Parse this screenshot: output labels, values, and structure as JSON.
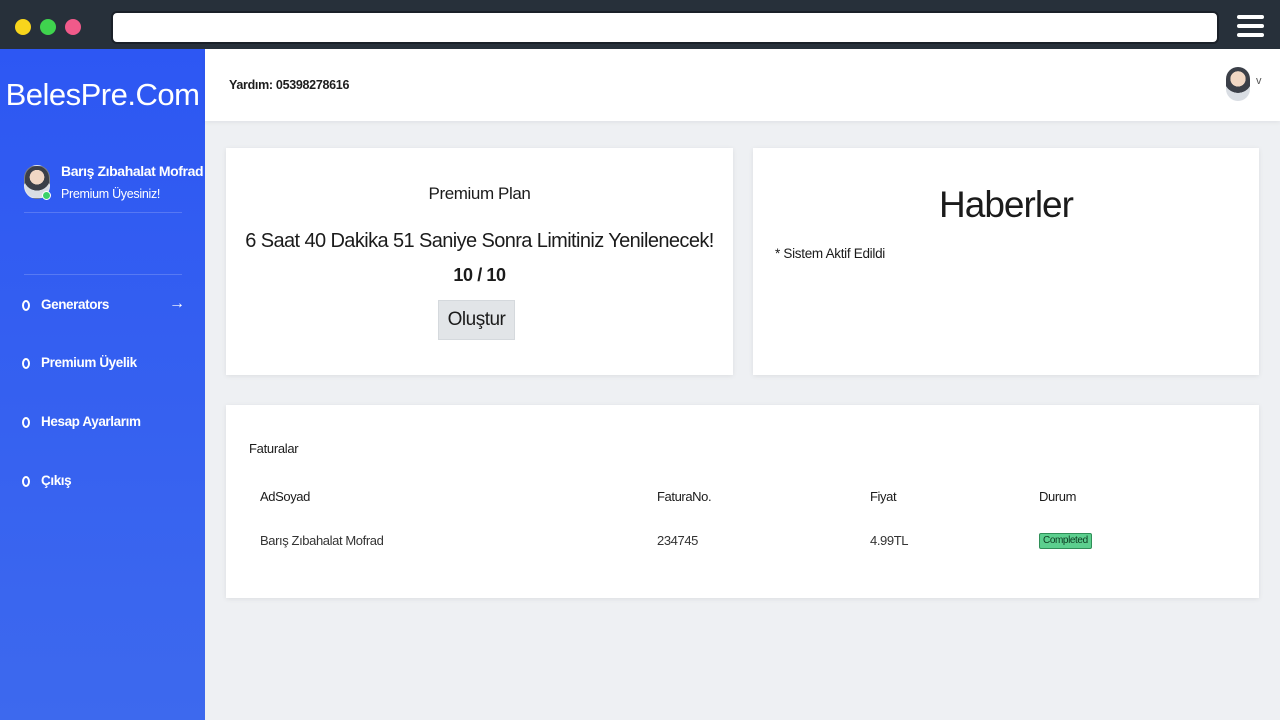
{
  "browser": {
    "url": ""
  },
  "sidebar": {
    "brand": "BelesPre.Com",
    "user": {
      "name": "Barış Zıbahalat Mofrad",
      "status": "Premium Üyesiniz!"
    },
    "items": [
      {
        "label": "Generators",
        "icon": "arrow-right-icon"
      },
      {
        "label": "Premium Üyelik"
      },
      {
        "label": "Hesap Ayarlarım"
      },
      {
        "label": "Çıkış"
      }
    ]
  },
  "header": {
    "help": "Yardım: 05398278616"
  },
  "plan": {
    "title": "Premium Plan",
    "timer": "6 Saat 40 Dakika 51 Saniye Sonra Limitiniz Yenilenecek!",
    "count": "10 / 10",
    "button": "Oluştur"
  },
  "news": {
    "title": "Haberler",
    "items": [
      "* Sistem Aktif Edildi"
    ]
  },
  "invoices": {
    "title": "Faturalar",
    "columns": [
      "AdSoyad",
      "FaturaNo.",
      "Fiyat",
      "Durum"
    ],
    "rows": [
      {
        "name": "Barış Zıbahalat Mofrad",
        "number": "234745",
        "price": "4.99TL",
        "status": "Completed"
      }
    ]
  },
  "colors": {
    "sidebar": "#2d57f3",
    "chrome": "#27303a",
    "status_completed": "#5ccf8e"
  }
}
